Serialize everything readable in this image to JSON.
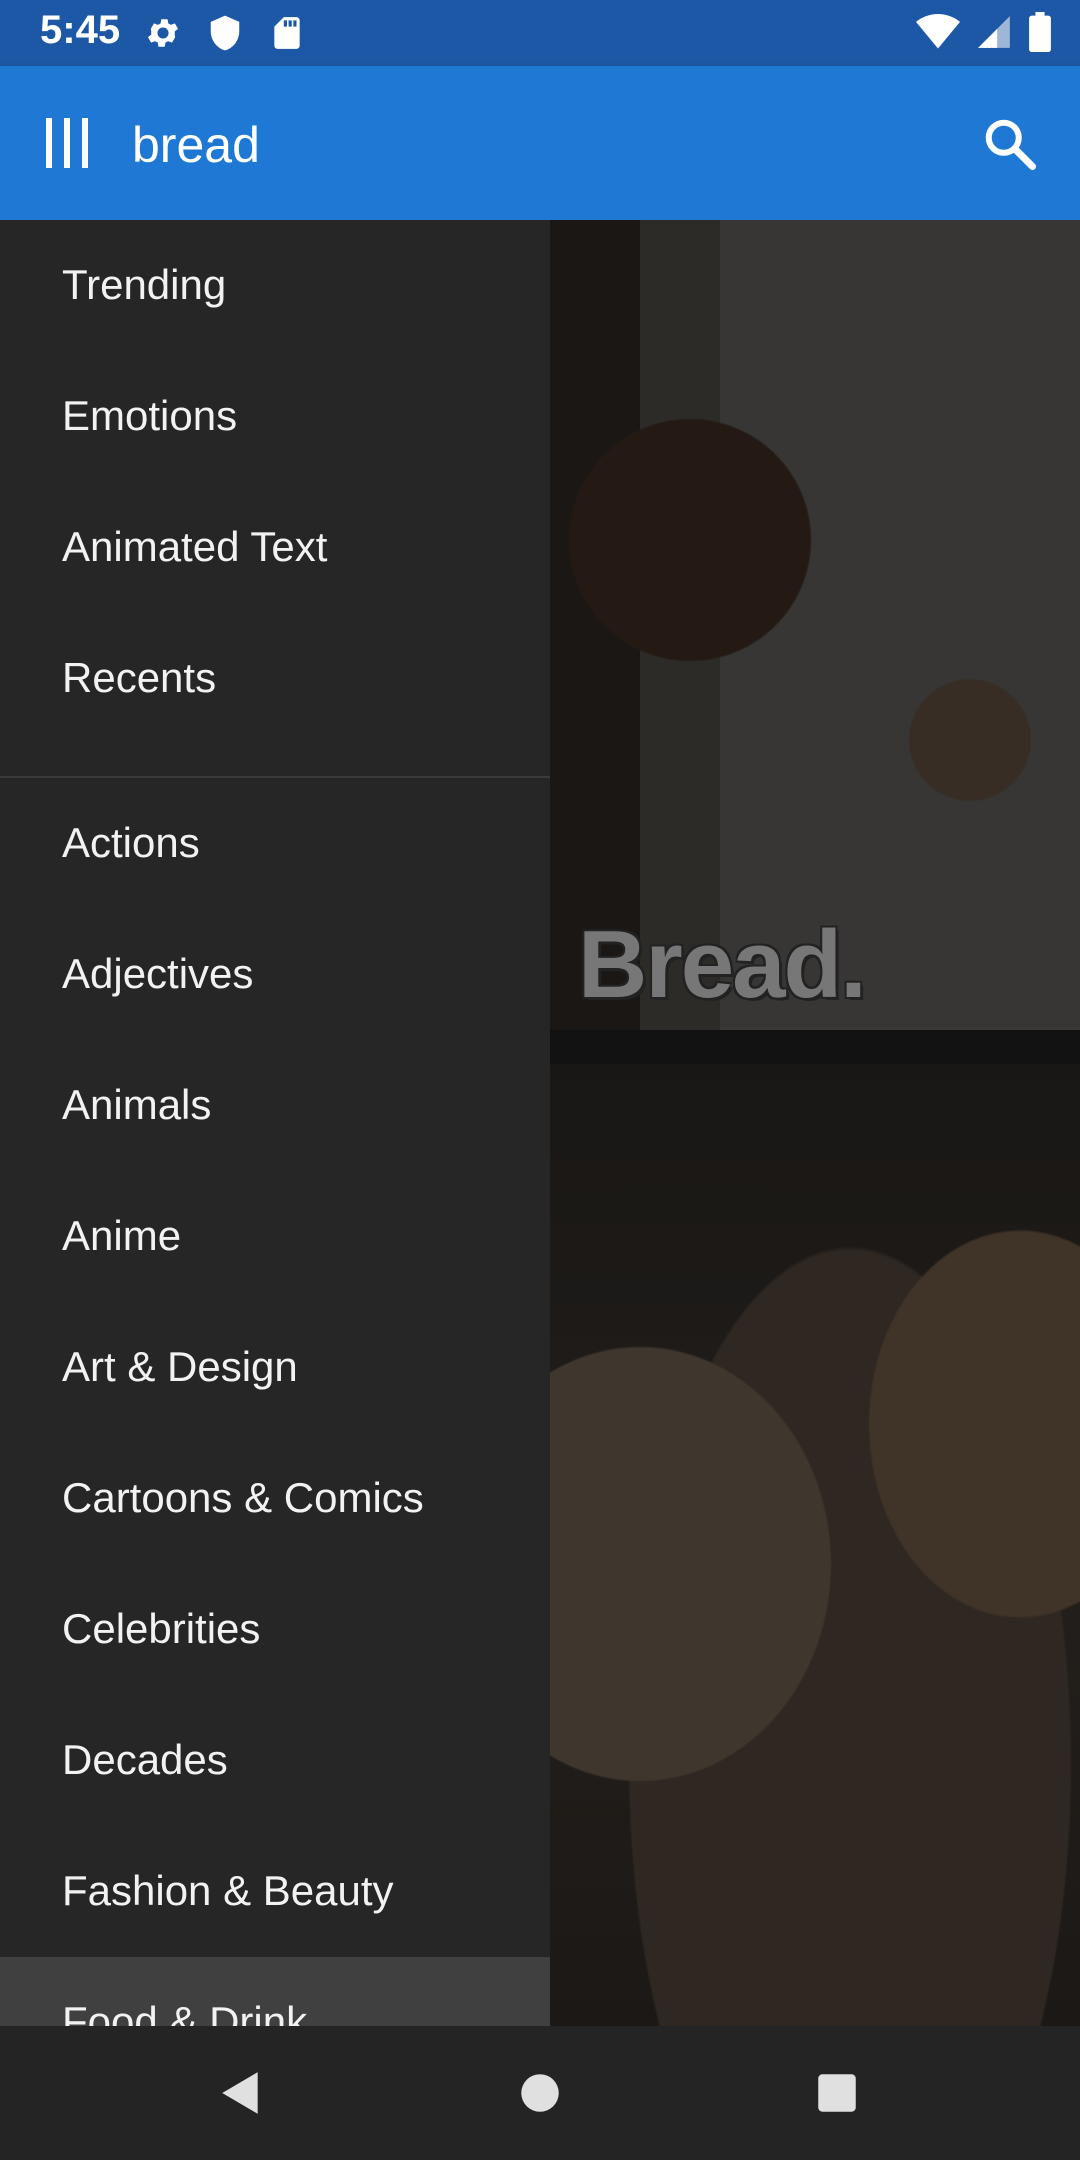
{
  "status_bar": {
    "time": "5:45",
    "left_icons": [
      "settings-icon",
      "shield-icon",
      "sd-card-icon"
    ],
    "right_icons": [
      "wifi-icon",
      "cellular-signal-icon",
      "battery-icon"
    ]
  },
  "app_bar": {
    "menu_icon": "menu-icon",
    "search_query": "bread",
    "search_icon": "search-icon",
    "color": "#1e78d4"
  },
  "drawer": {
    "top_items": [
      {
        "label": "Trending"
      },
      {
        "label": "Emotions"
      },
      {
        "label": "Animated Text"
      },
      {
        "label": "Recents"
      }
    ],
    "category_items": [
      {
        "label": "Actions"
      },
      {
        "label": "Adjectives"
      },
      {
        "label": "Animals"
      },
      {
        "label": "Anime"
      },
      {
        "label": "Art & Design"
      },
      {
        "label": "Cartoons & Comics"
      },
      {
        "label": "Celebrities"
      },
      {
        "label": "Decades"
      },
      {
        "label": "Fashion & Beauty"
      },
      {
        "label": "Food & Drink",
        "selected": true
      }
    ]
  },
  "content": {
    "card1_caption": "Bread."
  },
  "nav_bar": {
    "buttons": [
      "back-icon",
      "home-icon",
      "recents-icon"
    ]
  }
}
